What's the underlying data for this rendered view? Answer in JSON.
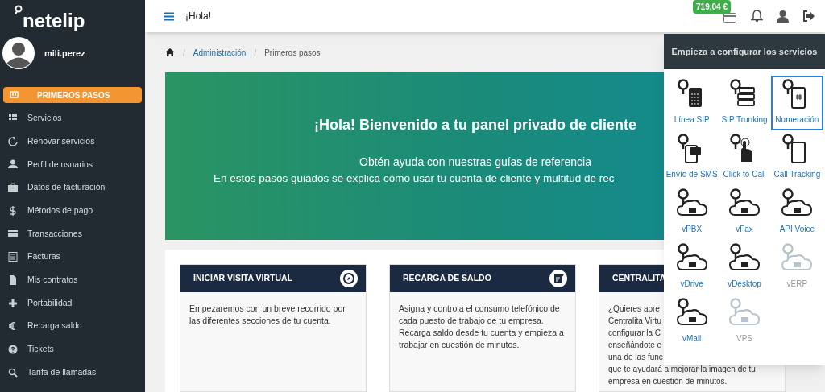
{
  "sidebar": {
    "logo": "netelip",
    "user": "mili.perez",
    "items": [
      {
        "label": "PRIMEROS PASOS",
        "selected": true
      },
      {
        "label": "Servicios",
        "selected": false
      },
      {
        "label": "Renovar servicios",
        "selected": false
      },
      {
        "label": "Perfil de usuarios",
        "selected": false
      },
      {
        "label": "Datos de facturación",
        "selected": false
      },
      {
        "label": "Métodos de pago",
        "selected": false
      },
      {
        "label": "Transacciones",
        "selected": false
      },
      {
        "label": "Facturas",
        "selected": false
      },
      {
        "label": "Mis contratos",
        "selected": false
      },
      {
        "label": "Portabilidad",
        "selected": false
      },
      {
        "label": "Recarga saldo",
        "selected": false
      },
      {
        "label": "Tickets",
        "selected": false
      },
      {
        "label": "Tarifa de llamadas",
        "selected": false
      }
    ]
  },
  "header": {
    "title": "¡Hola!",
    "balance": "719,04 €"
  },
  "breadcrumb": [
    "Administración",
    "Primeros pasos"
  ],
  "breadcrumb_separator": "/",
  "banner": {
    "title": "¡Hola! Bienvenido a tu panel privado de cliente",
    "subtitle": "Obtén ayuda con nuestras guías de referencia",
    "line": "En estos pasos guiados se explica cómo usar tu cuenta de cliente y multitud de rec"
  },
  "cards": [
    {
      "title": "INICIAR VISITA VIRTUAL",
      "lines": [
        "Empezaremos con un breve recorrido por las diferentes secciones de tu cuenta."
      ]
    },
    {
      "title": "RECARGA DE SALDO",
      "lines": [
        "Asigna y controla el consumo telefónico de cada puesto de trabajo de tu empresa. Recarga saldo desde tu cuenta y empieza a trabajar en cuestión de minutos."
      ]
    },
    {
      "title": "CENTRALITA",
      "lines": [
        "¿Quieres apre",
        "Centralita Virtu",
        "configurar la C",
        "enseñándote e",
        "una de las func",
        "que te ayudará a mejorar la imagen de tu",
        "empresa en cuestión de minutos."
      ]
    }
  ],
  "services_panel": {
    "title": "Empieza a configurar los servicios",
    "items": [
      {
        "label": "Línea SIP",
        "selected": false,
        "disabled": false
      },
      {
        "label": "SIP Trunking",
        "selected": false,
        "disabled": false
      },
      {
        "label": "Numeración",
        "selected": true,
        "disabled": false
      },
      {
        "label": "Envío de SMS",
        "selected": false,
        "disabled": false
      },
      {
        "label": "Click to Call",
        "selected": false,
        "disabled": false
      },
      {
        "label": "Call Tracking",
        "selected": false,
        "disabled": false
      },
      {
        "label": "vPBX",
        "selected": false,
        "disabled": false
      },
      {
        "label": "vFax",
        "selected": false,
        "disabled": false
      },
      {
        "label": "API Voice",
        "selected": false,
        "disabled": false
      },
      {
        "label": "vDrive",
        "selected": false,
        "disabled": false
      },
      {
        "label": "vDesktop",
        "selected": false,
        "disabled": false
      },
      {
        "label": "vERP",
        "selected": false,
        "disabled": true
      },
      {
        "label": "vMail",
        "selected": false,
        "disabled": false
      },
      {
        "label": "VPS",
        "selected": false,
        "disabled": true
      }
    ]
  }
}
